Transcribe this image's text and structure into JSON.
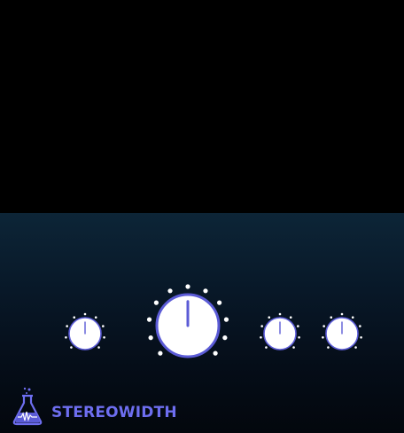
{
  "plugin": {
    "name": "STEREOWIDTH",
    "logo_icon": "flask-waveform-icon",
    "accent_color": "#6e6ef0",
    "knob_face_color": "#ffffff",
    "knob_ring_color": "#5b5bd6",
    "background_color": "#081828"
  },
  "knobs": [
    {
      "id": "knob-1",
      "value": 0.5
    },
    {
      "id": "knob-main",
      "value": 0.5
    },
    {
      "id": "knob-3",
      "value": 0.5
    },
    {
      "id": "knob-4",
      "value": 0.5
    }
  ]
}
